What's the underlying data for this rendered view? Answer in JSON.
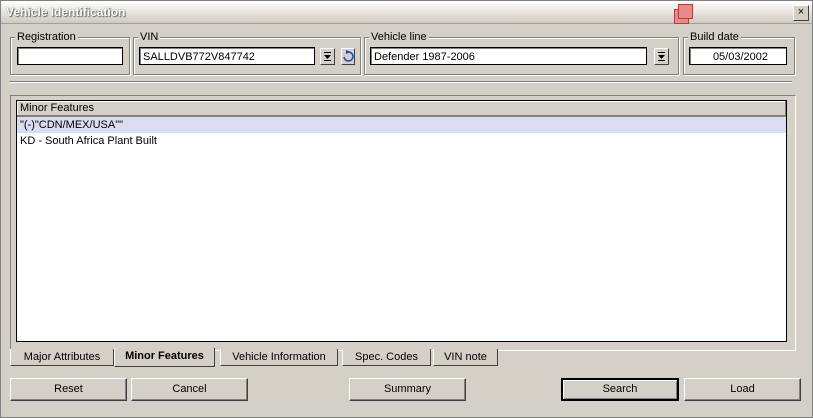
{
  "window": {
    "title": "Vehicle Identification",
    "close_label": "×"
  },
  "registration": {
    "label": "Registration",
    "value": ""
  },
  "vin": {
    "label": "VIN",
    "value": "SALLDVB772V847742"
  },
  "vehicle_line": {
    "label": "Vehicle line",
    "value": "Defender 1987-2006"
  },
  "build_date": {
    "label": "Build date",
    "value": "05/03/2002"
  },
  "list": {
    "header": "Minor Features",
    "items": [
      "\"(-)\"CDN/MEX/USA\"\"",
      "KD - South Africa Plant Built"
    ]
  },
  "tabs": [
    "Major Attributes",
    "Minor Features",
    "Vehicle Information",
    "Spec. Codes",
    "VIN note"
  ],
  "buttons": {
    "reset": "Reset",
    "cancel": "Cancel",
    "summary": "Summary",
    "search": "Search",
    "load": "Load"
  },
  "colors": {
    "selection": "#dcdcf0",
    "chrome": "#d4d0c8"
  }
}
